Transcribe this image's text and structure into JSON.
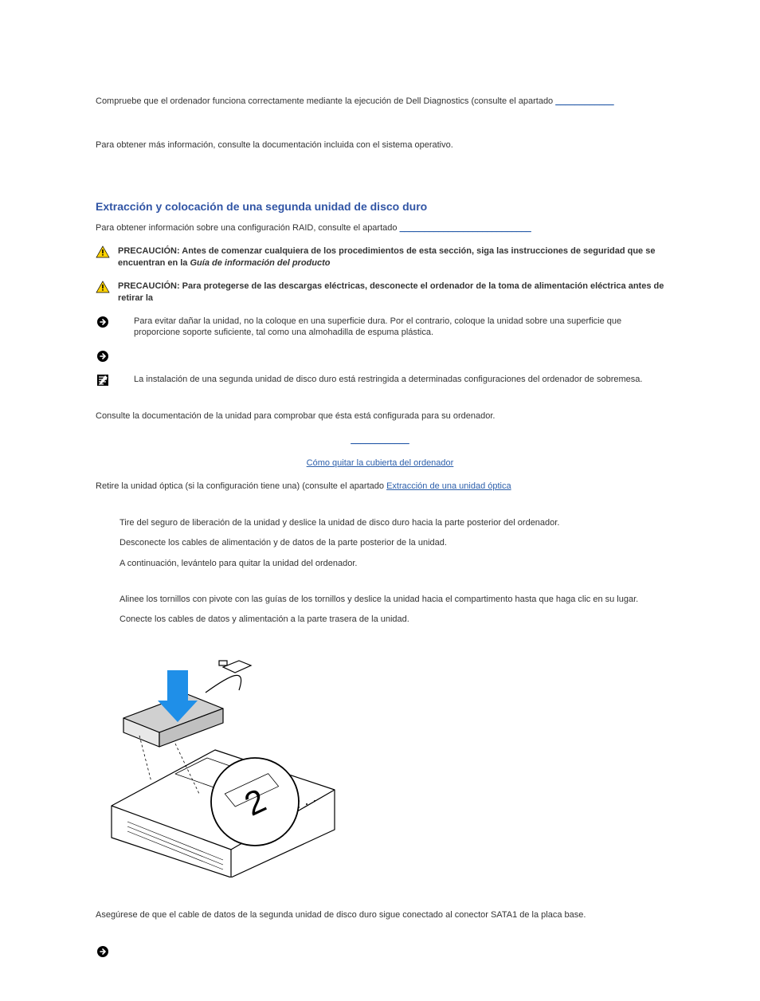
{
  "intro": {
    "dell_diag_text": "Compruebe que el ordenador funciona correctamente mediante la ejecución de Dell Diagnostics (consulte el apartado ",
    "dell_diag_link": "____________",
    "more_info": "Para obtener más información, consulte la documentación incluida con el sistema operativo."
  },
  "section": {
    "title": "Extracción y colocación de una segunda unidad de disco duro",
    "raid_text": "Para obtener información sobre una configuración RAID, consulte el apartado ",
    "raid_link": "___________________________"
  },
  "callouts": {
    "caution1": {
      "label": "PRECAUCIÓN: ",
      "text": "Antes de comenzar cualquiera de los procedimientos de esta sección, siga las instrucciones de seguridad que se encuentran en la ",
      "guide": "Guía de información del producto"
    },
    "caution2": {
      "label": "PRECAUCIÓN: ",
      "text": "Para protegerse de las descargas eléctricas, desconecte el ordenador de la toma de alimentación eléctrica antes de retirar la "
    },
    "notice1": {
      "text": "Para evitar dañar la unidad, no la coloque en una superficie dura. Por el contrario, coloque la unidad sobre una superficie que proporcione soporte suficiente, tal como una almohadilla de espuma plástica."
    },
    "note1": {
      "text": "La instalación de una segunda unidad de disco duro está restringida a determinadas configuraciones del ordenador de sobremesa."
    }
  },
  "steps": {
    "s1": "Consulte la documentación de la unidad para comprobar que ésta está configurada para su ordenador.",
    "s2_link": "____________",
    "s3_link": "Cómo quitar la cubierta del ordenador",
    "s4_pre": "Retire la unidad óptica (si la configuración tiene una) (consulte el apartado ",
    "s4_link": "Extracción de una unidad óptica",
    "s5": "Tire del seguro de liberación de la unidad y deslice la unidad de disco duro hacia la parte posterior del ordenador.",
    "s6": "Desconecte los cables de alimentación y de datos de la parte posterior de la unidad.",
    "s7": "A continuación, levántelo para quitar la unidad del ordenador.",
    "s8": "Alinee los tornillos con pivote con las guías de los tornillos y deslice la unidad hacia el compartimento hasta que haga clic en su lugar.",
    "s9": "Conecte los cables de datos y alimentación a la parte trasera de la unidad.",
    "s10": "Asegúrese de que el cable de datos de la segunda unidad de disco duro sigue conectado al conector SATA1 de la placa base."
  }
}
